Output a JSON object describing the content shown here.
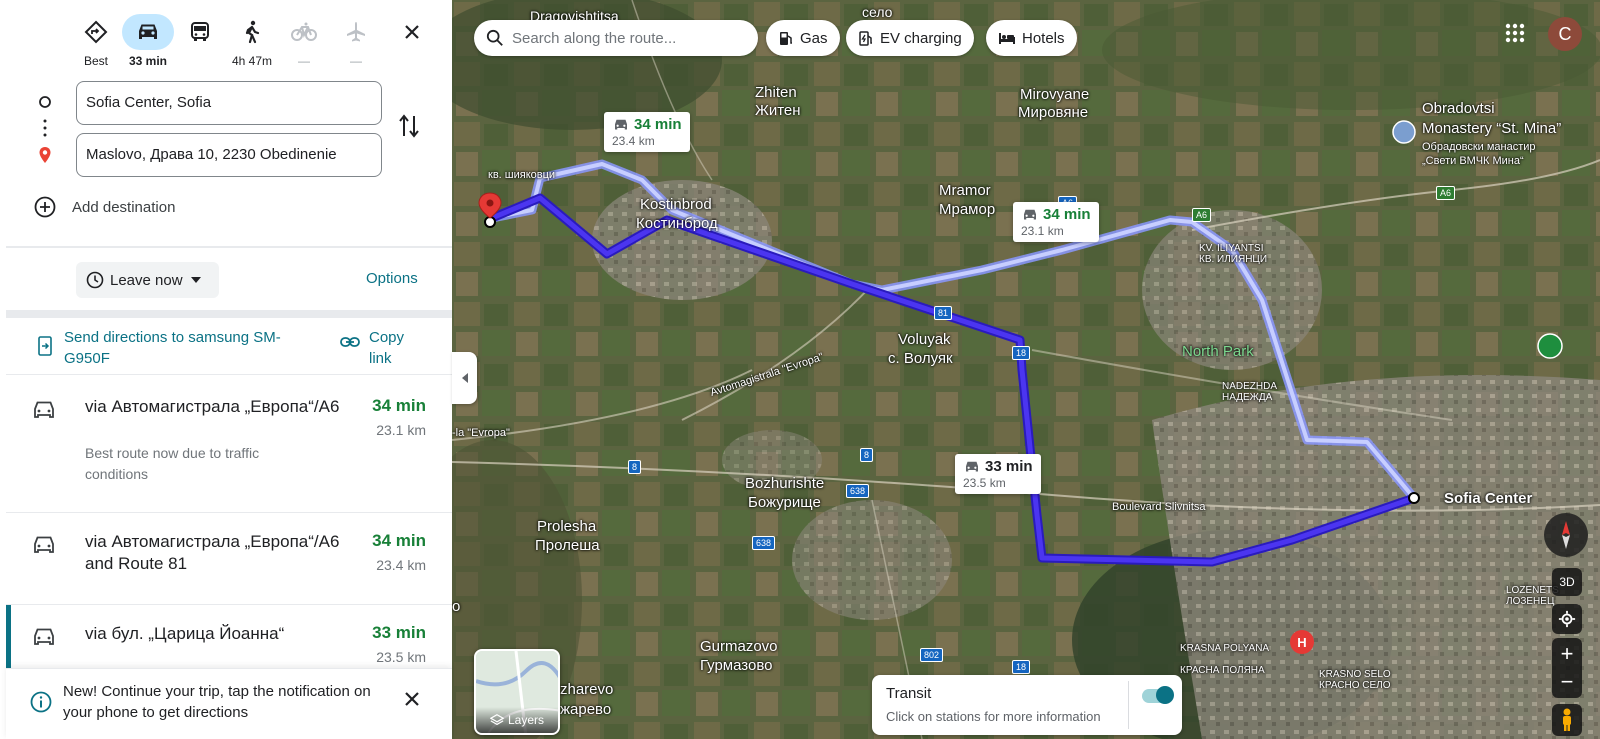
{
  "travel_modes": [
    {
      "name": "best",
      "label": "Best",
      "active": false,
      "disabled": false
    },
    {
      "name": "driving",
      "label": "33 min",
      "active": true,
      "disabled": false
    },
    {
      "name": "transit",
      "label": "",
      "active": false,
      "disabled": false
    },
    {
      "name": "walking",
      "label": "4h 47m",
      "active": false,
      "disabled": false
    },
    {
      "name": "cycling",
      "label": "—",
      "active": false,
      "disabled": true
    },
    {
      "name": "flights",
      "label": "—",
      "active": false,
      "disabled": true
    }
  ],
  "waypoints": {
    "origin": "Sofia Center, Sofia",
    "destination": "Maslovo, Драва 10, 2230 Obedinenie",
    "add_destination": "Add destination"
  },
  "leave_now": "Leave now",
  "options": "Options",
  "send_directions": "Send directions to samsung SM-G950F",
  "copy_link": "Copy link",
  "routes": [
    {
      "title": "via Автомагистрала „Европа“/A6",
      "desc": "Best route now due to traffic conditions",
      "time": "34 min",
      "distance": "23.1 km",
      "selected": false
    },
    {
      "title": "via Автомагистрала „Европа“/A6 and Route 81",
      "desc": "",
      "time": "34 min",
      "distance": "23.4 km",
      "selected": false
    },
    {
      "title": "via бул. „Царица Йоанна“",
      "desc": "",
      "time": "33 min",
      "distance": "23.5 km",
      "selected": true
    }
  ],
  "notification": "New! Continue your trip, tap the notification on your phone to get directions",
  "search": {
    "placeholder": "Search along the route..."
  },
  "chips": {
    "gas": "Gas",
    "ev": "EV charging",
    "hotels": "Hotels"
  },
  "avatar_letter": "C",
  "callouts": [
    {
      "time": "34 min",
      "distance": "23.4 km"
    },
    {
      "time": "34 min",
      "distance": "23.1 km"
    },
    {
      "time": "33 min",
      "distance": "23.5 km"
    }
  ],
  "map_labels": {
    "dragovishtitsa": "Dragovishtitsa",
    "selo": "село",
    "zhiten": "Zhiten",
    "zhiten_cyr": "Житен",
    "mirovyane": "Mirovyane",
    "mirovyane_cyr": "Мировяне",
    "obradovtsi": "Obradovtsi",
    "monastery": "Monastery “St. Mina”",
    "monastery_cyr1": "Обрадовски манастир",
    "monastery_cyr2": "„Свети ВМЧК Мина“",
    "kv_shiyakovtsi": "кв. шияковци",
    "kostinbrod": "Kostinbrod",
    "kostinbrod_cyr": "Костинброд",
    "mramor": "Mramor",
    "mramor_cyr": "Мрамор",
    "iliyantsi": "KV. ILIYANTSI",
    "iliyantsi_cyr": "КВ. ИЛИЯНЦИ",
    "voluyak": "Voluyak",
    "voluyak_cyr": "с. Волуяк",
    "north_park": "North Park",
    "nadezhda": "NADEZHDA",
    "nadezhda_cyr": "НАДЕЖДА",
    "avtomagistrala": "Avtomagistrala \"Evropa\"",
    "evropa": "-la \"Evropa\"",
    "bozhurishte": "Bozhurishte",
    "bozhurishte_cyr": "Божурище",
    "boulevard": "Boulevard Slivnitsa",
    "sofia_center": "Sofia Center",
    "proleshs": "Proleshа",
    "proleshs_cyr": "Пролеша",
    "gurmazovo": "Gurmazovo",
    "gurmazovo_cyr": "Гурмазово",
    "zharevo": "zharevo",
    "zharevo_cyr": "жарево",
    "krasna_polyana": "KRASNA POLYANA",
    "krasna_cyr": "КРАСНА ПОЛЯНА",
    "krasno_selo": "KRASNO SELO",
    "krasno_selo_cyr": "КРАСНО СЕЛО",
    "lozenets": "LOZENETS",
    "lozenets_cyr": "ЛОЗЕНЕЦ",
    "o": "o"
  },
  "road_shields": [
    "A6",
    "81",
    "18",
    "8",
    "8",
    "638",
    "638",
    "802",
    "18",
    "A6",
    "A6"
  ],
  "layers_label": "Layers",
  "transit": {
    "title": "Transit",
    "subtitle": "Click on stations for more information"
  },
  "controls": {
    "three_d": "3D",
    "zoom_in": "+",
    "zoom_out": "−"
  },
  "colors": {
    "accent": "#0b7285",
    "route_selected": "#3b22e8",
    "route_alt": "#9aa8ff",
    "time_green": "#188038"
  }
}
